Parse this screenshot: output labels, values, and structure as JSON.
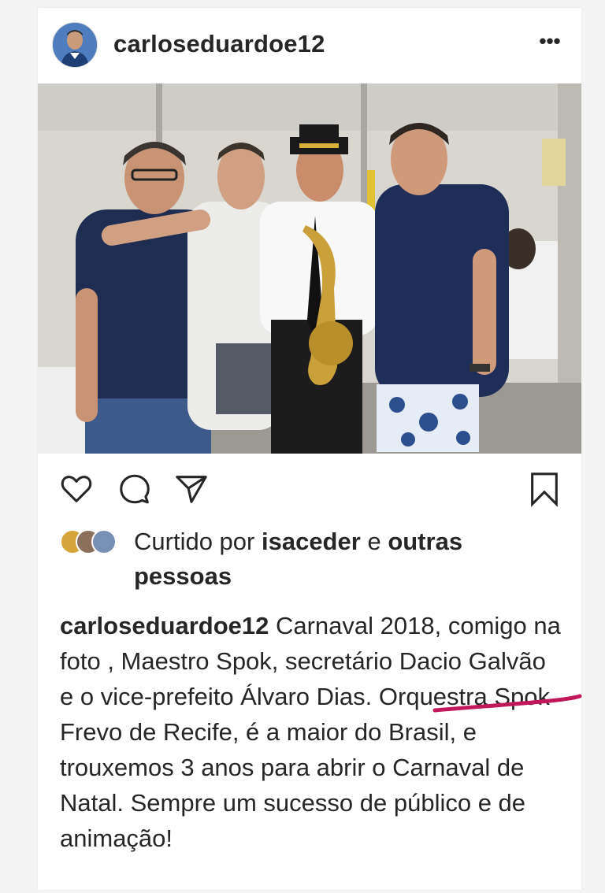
{
  "post": {
    "username": "carloseduardoe12",
    "more_label": "•••",
    "photo_alt": "",
    "actions": {
      "like_icon": "heart-icon",
      "comment_icon": "comment-icon",
      "share_icon": "send-icon",
      "save_icon": "bookmark-icon"
    },
    "likes": {
      "prefix": "Curtido por",
      "user": "isaceder",
      "joiner": "e",
      "others": "outras pessoas"
    },
    "caption": {
      "username": "carloseduardoe12",
      "text": "Carnaval 2018, comigo na foto , Maestro Spok, secretário Dacio Galvão e o vice-prefeito Álvaro Dias. Orquestra Spok Frevo de Recife, é a maior do Brasil, e trouxemos 3 anos para abrir o Carnaval de Natal. Sempre um sucesso de público e de animação!"
    },
    "annotation_color": "#c2185b"
  }
}
